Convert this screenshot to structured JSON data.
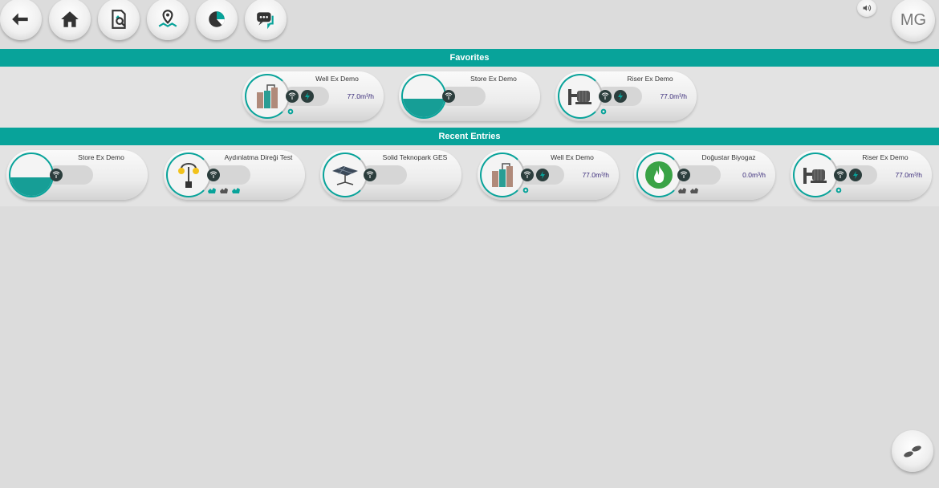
{
  "toolbar": {
    "buttons": [
      {
        "icon": "back-arrow-icon"
      },
      {
        "icon": "home-icon"
      },
      {
        "icon": "document-search-icon"
      },
      {
        "icon": "map-pin-icon"
      },
      {
        "icon": "pie-chart-icon"
      },
      {
        "icon": "chat-icon"
      }
    ],
    "sound_icon": "speaker-icon",
    "avatar_initials": "MG"
  },
  "colors": {
    "accent": "#08a39a",
    "dark_dot": "#2c3e3d",
    "value_text": "#3a2b7a"
  },
  "favorites": {
    "title": "Favorites",
    "cards": [
      {
        "title": "Well Ex Demo",
        "icon": "well-tank-icon",
        "flow": "77.0m³/h"
      },
      {
        "title": "Store Ex Demo",
        "icon": "storage-tank-icon",
        "flow": ""
      },
      {
        "title": "Riser Ex Demo",
        "icon": "riser-pump-icon",
        "flow": "77.0m³/h"
      }
    ]
  },
  "recent": {
    "title": "Recent Entries",
    "cards": [
      {
        "title": "Store Ex Demo",
        "icon": "storage-tank-icon",
        "flow": ""
      },
      {
        "title": "Aydınlatma Direği Test",
        "icon": "street-lamp-icon",
        "flow": ""
      },
      {
        "title": "Solid Teknopark GES",
        "icon": "solar-panel-icon",
        "flow": ""
      },
      {
        "title": "Well Ex Demo",
        "icon": "well-tank-icon",
        "flow": "77.0m³/h"
      },
      {
        "title": "Doğustar Biyogaz",
        "icon": "flame-icon",
        "flow": "0.0m³/h"
      },
      {
        "title": "Riser Ex Demo",
        "icon": "riser-pump-icon",
        "flow": "77.0m³/h"
      }
    ]
  },
  "footer": {
    "icon": "footprints-icon"
  }
}
